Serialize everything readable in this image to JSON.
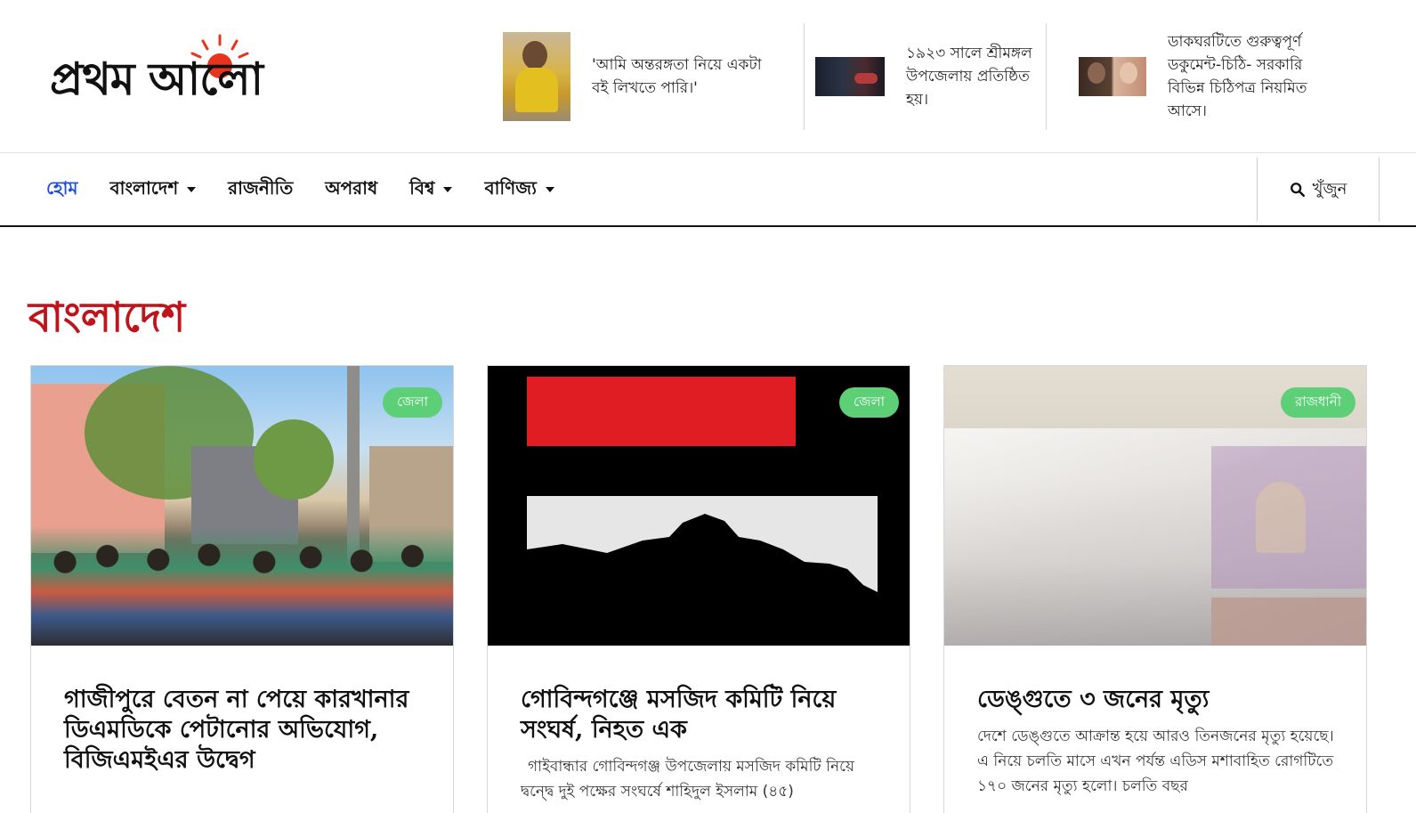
{
  "header": {
    "logo_text": "প্রথম আলো",
    "teasers": [
      {
        "text": "'আমি অন্তরঙ্গতা নিয়ে একটা বই লিখতে পারি।'"
      },
      {
        "text": "১৯২৩ সালে শ্রীমঙ্গল উপজেলায় প্রতিষ্ঠিত হয়।"
      },
      {
        "text": "ডাকঘরটিতে গুরুত্বপূর্ণ ডকুমেন্ট-চিঠি- সরকারি বিভিন্ন চিঠিপত্র নিয়মিত আসে।"
      }
    ]
  },
  "nav": {
    "items": [
      {
        "label": "হোম"
      },
      {
        "label": "বাংলাদেশ"
      },
      {
        "label": "রাজনীতি"
      },
      {
        "label": "অপরাধ"
      },
      {
        "label": "বিশ্ব"
      },
      {
        "label": "বাণিজ্য"
      }
    ],
    "search_label": "খুঁজুন"
  },
  "section": {
    "title": "বাংলাদেশ"
  },
  "cards": [
    {
      "badge": "জেলা",
      "title": "গাজীপুরে বেতন না পেয়ে কারখানার ডিএমডিকে পেটানোর অভিযোগ, বিজিএমইএর উদ্বেগ",
      "summary": ""
    },
    {
      "badge": "জেলা",
      "title": "গোবিন্দগঞ্জে মসজিদ কমিটি নিয়ে সংঘর্ষ, নিহত এক",
      "summary": "গাইবান্ধার গোবিন্দগঞ্জ উপজেলায় মসজিদ কমিটি নিয়ে দ্বন্দ্বে দুই পক্ষের সংঘর্ষে শাহিদুল ইসলাম (৪৫)"
    },
    {
      "badge": "রাজধানী",
      "title": "ডেঙ্গুতে ৩ জনের মৃত্যু",
      "summary": "দেশে ডেঙ্গুতে আক্রান্ত হয়ে আরও তিনজনের মৃত্যু হয়েছে। এ নিয়ে চলতি মাসে এখন পর্যন্ত এডিস মশাবাহিত রোগটিতে ১৭০ জনের মৃত্যু হলো। চলতি বছর"
    }
  ],
  "colors": {
    "accent_red": "#c0141c",
    "active_nav": "#1e4ed8",
    "badge_green": "#5ccf77",
    "logo_sun": "#e8341c"
  }
}
